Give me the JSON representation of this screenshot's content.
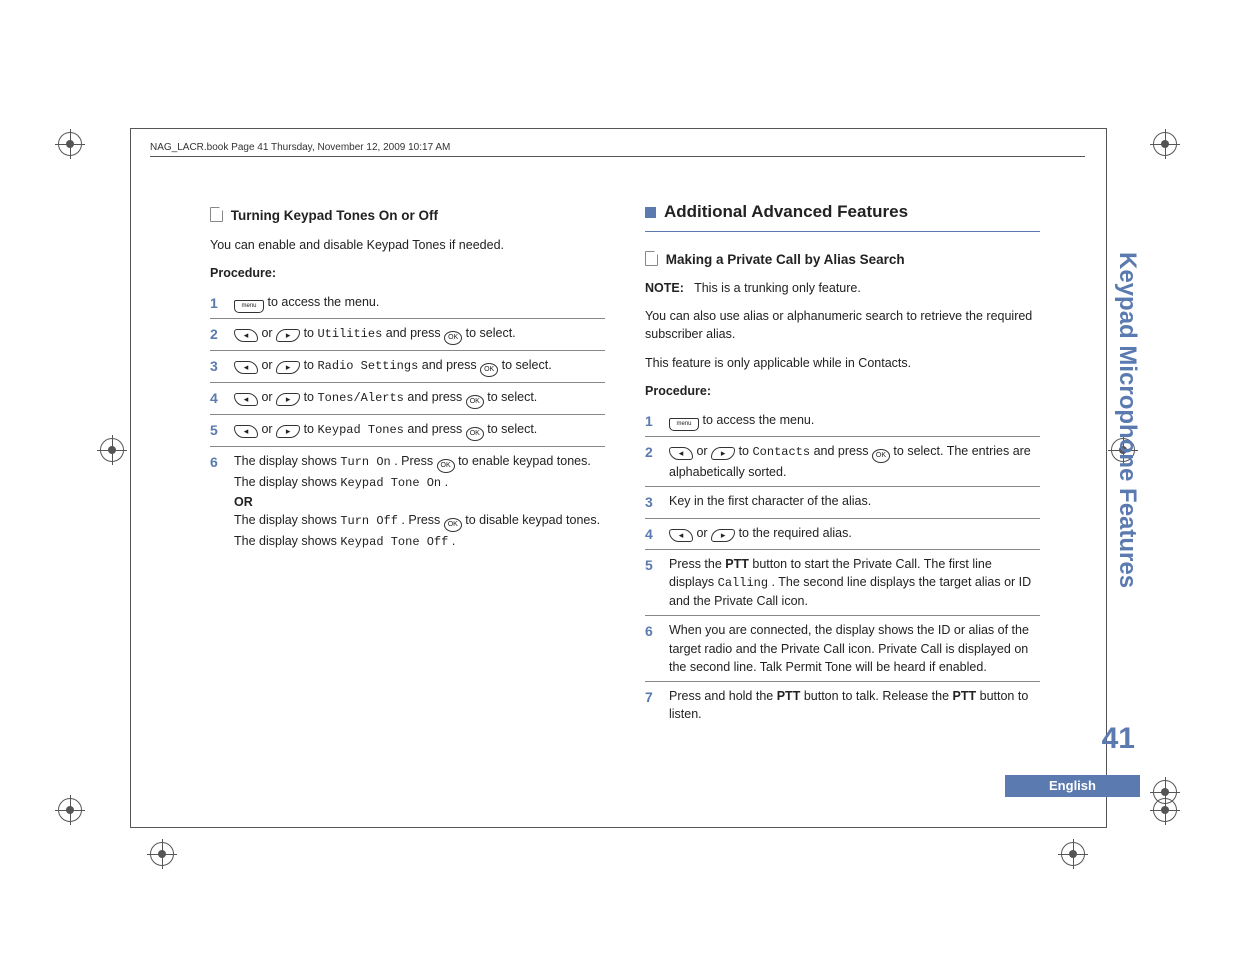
{
  "header": "NAG_LACR.book  Page 41  Thursday, November 12, 2009  10:17 AM",
  "left": {
    "title": "Turning Keypad Tones On or Off",
    "intro": "You can enable and disable Keypad Tones if needed.",
    "procedure_label": "Procedure:",
    "steps": {
      "s1_text": " to access the menu.",
      "s2_pre": " or ",
      "s2_mid": " to ",
      "s2_menu": "Utilities",
      "s2_post1": " and press ",
      "s2_post2": " to select.",
      "s3_menu": "Radio Settings",
      "s4_menu": "Tones/Alerts",
      "s5_menu": "Keypad Tones",
      "s6_a1": "The display shows ",
      "s6_a2": "Turn On",
      "s6_a3": ". Press ",
      "s6_a4": " to enable keypad tones. The display shows ",
      "s6_a5": "Keypad Tone On",
      "s6_a6": ".",
      "s6_or": "OR",
      "s6_b1": "The display shows ",
      "s6_b2": "Turn Off",
      "s6_b3": ". Press ",
      "s6_b4": " to disable keypad tones. The display shows ",
      "s6_b5": "Keypad Tone Off",
      "s6_b6": "."
    }
  },
  "right": {
    "section": "Additional Advanced Features",
    "title": "Making a Private Call by Alias Search",
    "note_label": "NOTE:",
    "note_text": "This is a trunking only feature.",
    "p1": "You can also use alias or alphanumeric search to retrieve the required subscriber alias.",
    "p2": "This feature is only applicable while in Contacts.",
    "procedure_label": "Procedure:",
    "steps": {
      "s1_text": " to access the menu.",
      "s2_menu": "Contacts",
      "s2_post": " to select. The entries are alphabetically sorted.",
      "s3": "Key in the first character of the alias.",
      "s4_post": " to the required alias.",
      "s5_a": "Press the ",
      "s5_ptt": "PTT",
      "s5_b": " button to start the Private Call. The first line displays ",
      "s5_calling": "Calling",
      "s5_c": ". The second line displays the target alias or ID and the Private Call icon.",
      "s6": "When you are connected, the display shows the ID or alias of the target radio and the Private Call icon. Private Call is displayed on the second line. Talk Permit Tone will be heard if enabled.",
      "s7_a": "Press and hold the ",
      "s7_b": " button to talk. Release the ",
      "s7_c": " button to listen."
    }
  },
  "side": {
    "title": "Keypad Microphone Features",
    "page": "41",
    "lang": "English"
  },
  "icons": {
    "menu": "menu",
    "ok": "OK",
    "left": "◂",
    "right": "▸"
  }
}
